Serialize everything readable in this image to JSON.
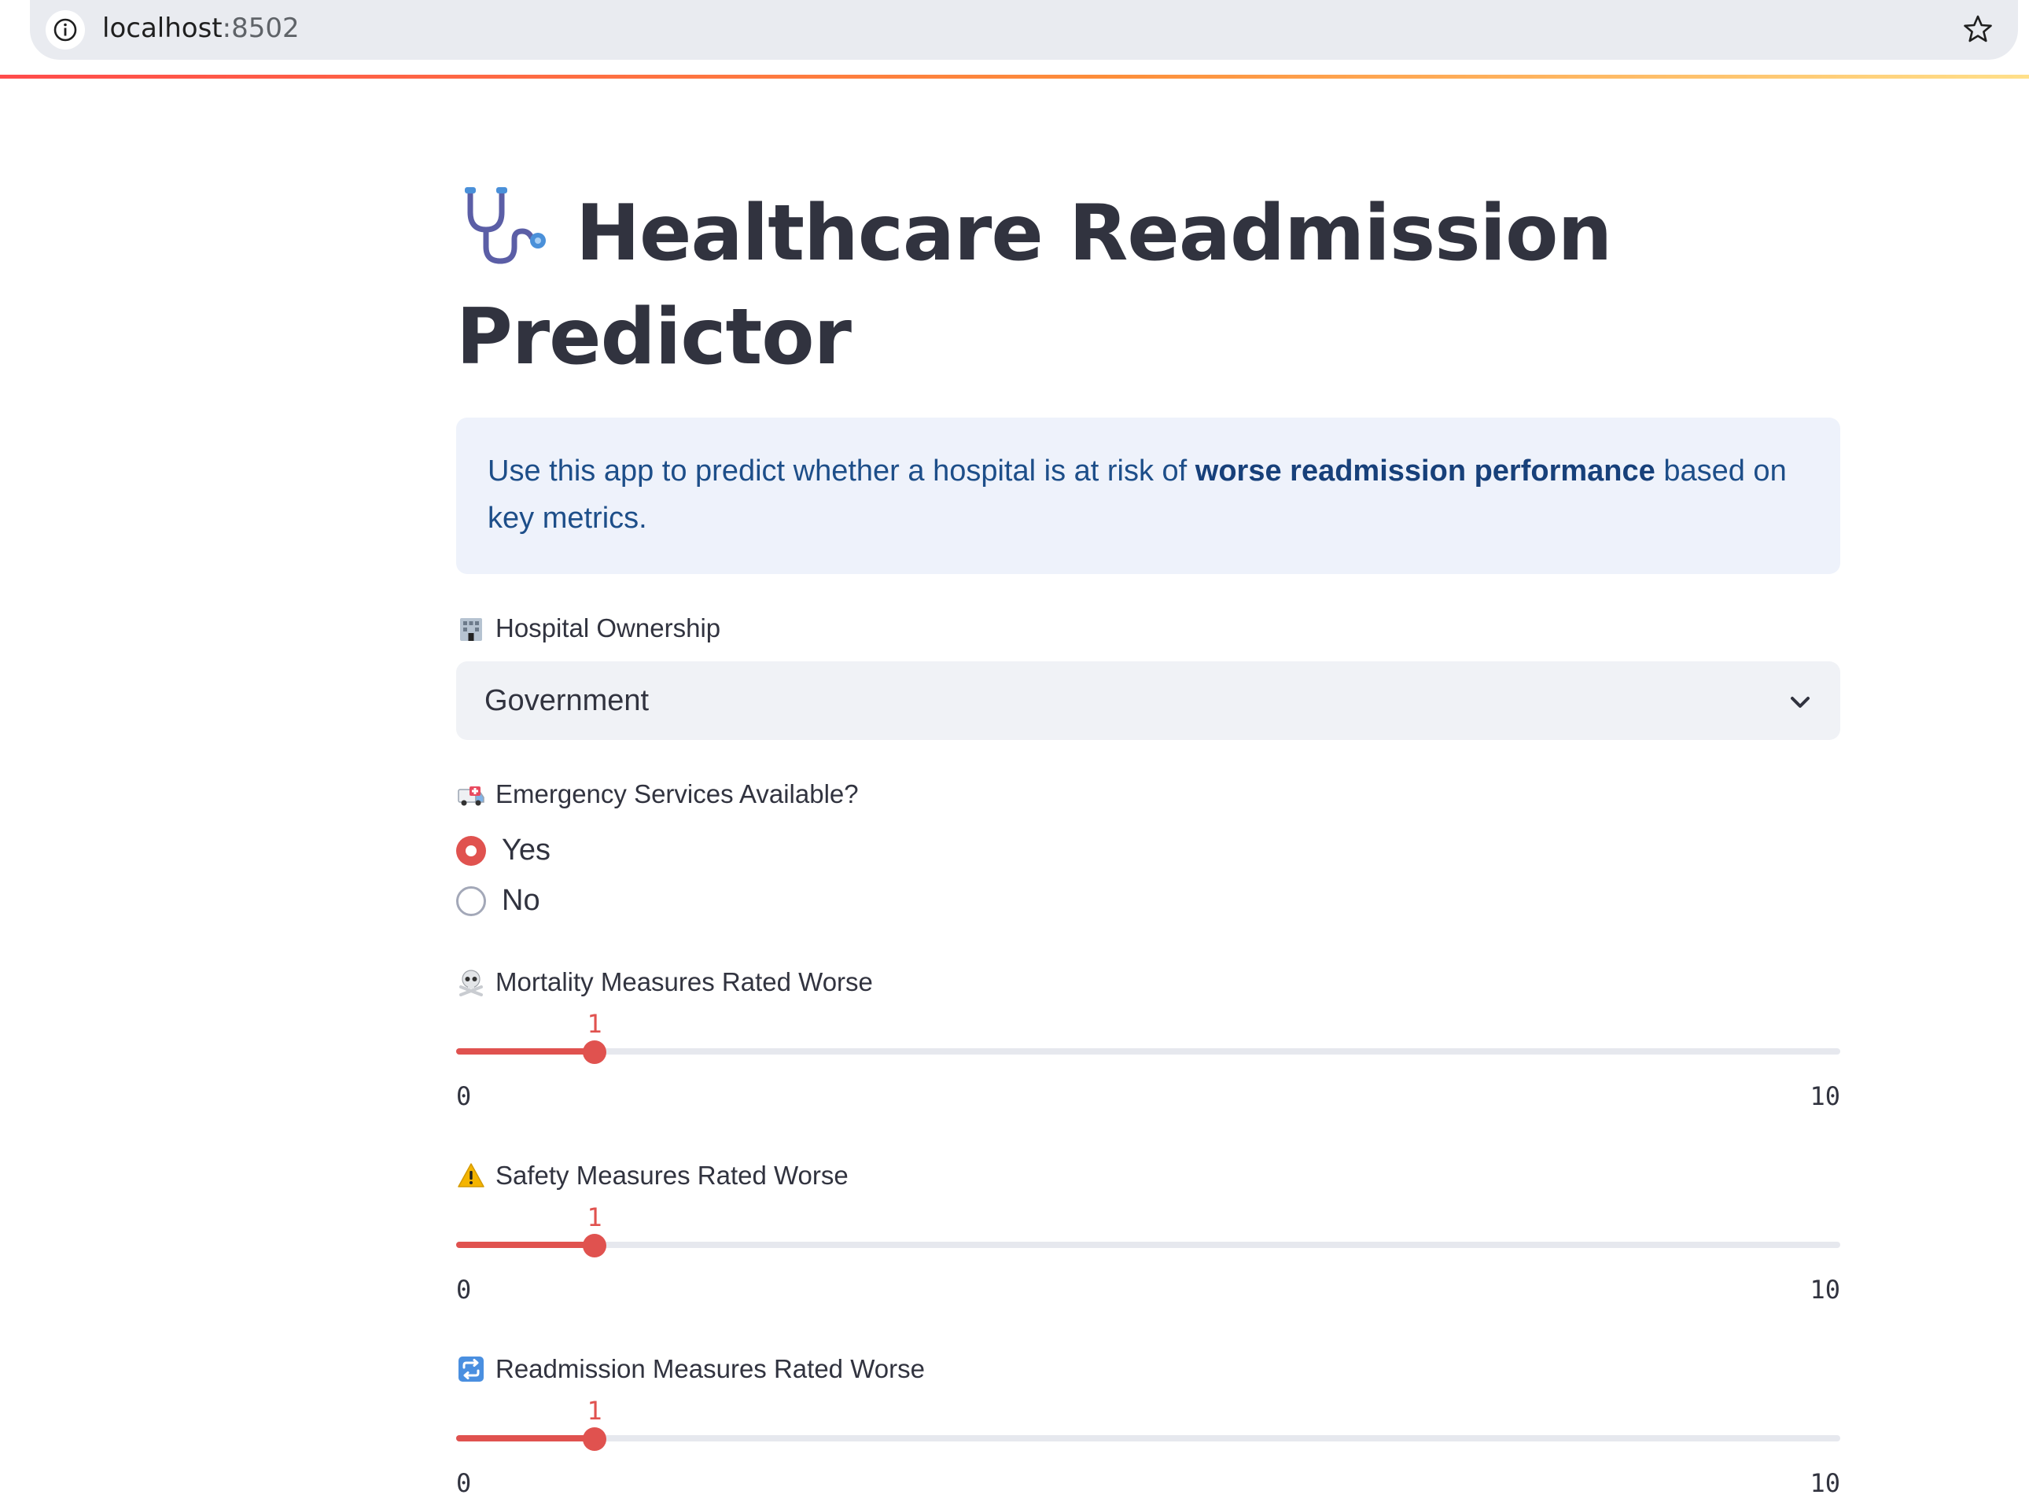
{
  "browser": {
    "url_host": "localhost",
    "url_port": ":8502"
  },
  "page": {
    "title": "Healthcare Readmission Predictor",
    "title_icon": "stethoscope-icon",
    "info": {
      "prefix": "Use this app to predict whether a hospital is at risk of ",
      "bold": "worse readmission performance",
      "suffix": " based on key metrics."
    }
  },
  "ownership": {
    "label": "Hospital Ownership",
    "icon": "hospital-icon",
    "selected": "Government"
  },
  "emergency": {
    "label": "Emergency Services Available?",
    "icon": "ambulance-icon",
    "options": [
      "Yes",
      "No"
    ],
    "selected": "Yes"
  },
  "sliders": [
    {
      "label": "Mortality Measures Rated Worse",
      "icon": "skull-crossbones-icon",
      "value": 1,
      "min": 0,
      "max": 10
    },
    {
      "label": "Safety Measures Rated Worse",
      "icon": "warning-icon",
      "value": 1,
      "min": 0,
      "max": 10
    },
    {
      "label": "Readmission Measures Rated Worse",
      "icon": "repeat-icon",
      "value": 1,
      "min": 0,
      "max": 10
    }
  ],
  "colors": {
    "accent": "#e0524f",
    "info_bg": "#eef2fb",
    "info_text": "#1d4e89",
    "select_bg": "#f0f2f6"
  }
}
